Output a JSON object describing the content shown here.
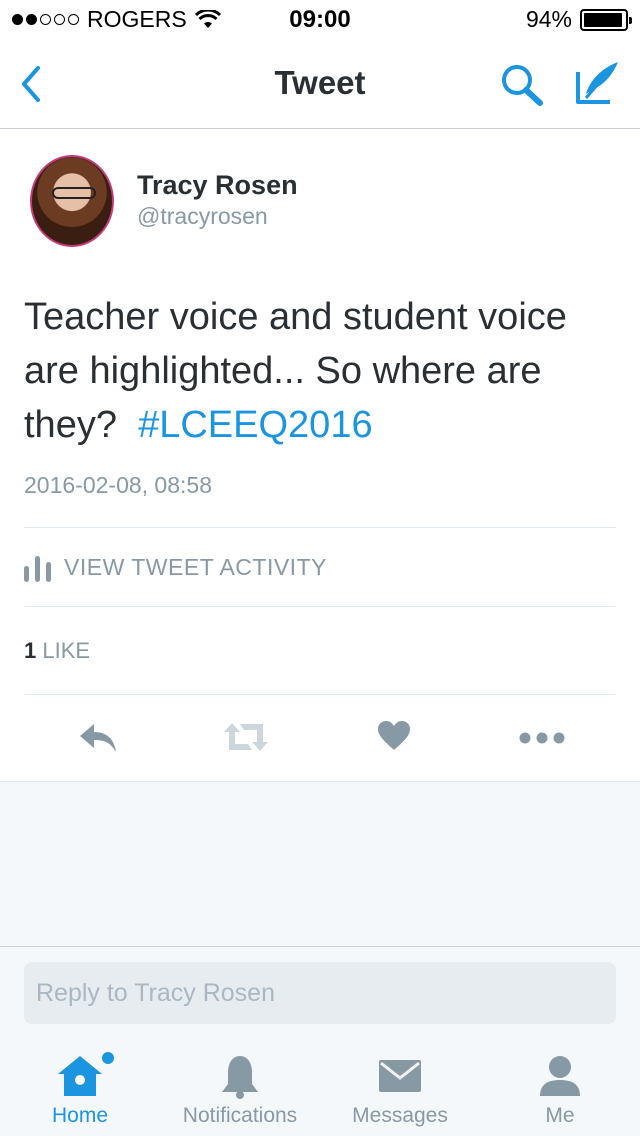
{
  "status_bar": {
    "carrier": "ROGERS",
    "time": "09:00",
    "battery": "94%",
    "battery_level": 0.94
  },
  "nav": {
    "title": "Tweet",
    "back_icon": "chevron-left-icon",
    "search_icon": "search-icon",
    "compose_icon": "compose-icon"
  },
  "tweet": {
    "author_name": "Tracy Rosen",
    "author_handle": "@tracyrosen",
    "text": "Teacher voice and student voice are highlighted... So where are they?",
    "hashtag": "#LCEEQ2016",
    "timestamp": "2016-02-08, 08:58",
    "activity_label": "VIEW TWEET ACTIVITY",
    "likes_count": "1",
    "likes_label": "LIKE"
  },
  "reply": {
    "placeholder": "Reply to Tracy Rosen"
  },
  "tabs": [
    {
      "label": "Home",
      "icon": "home-icon",
      "active": true
    },
    {
      "label": "Notifications",
      "icon": "bell-icon",
      "active": false
    },
    {
      "label": "Messages",
      "icon": "envelope-icon",
      "active": false
    },
    {
      "label": "Me",
      "icon": "person-icon",
      "active": false
    }
  ],
  "colors": {
    "accent": "#1b95e0",
    "muted": "#8899a6",
    "text": "#292f33",
    "icon_gray": "#8899a6"
  }
}
